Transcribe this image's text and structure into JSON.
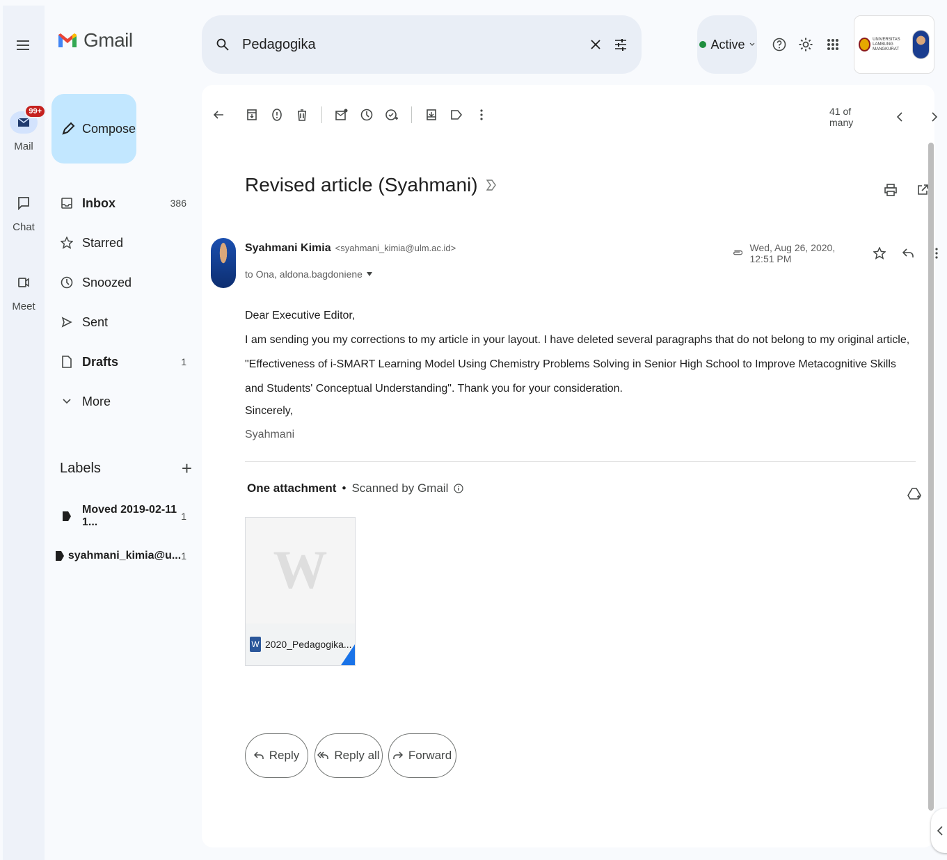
{
  "app": {
    "name": "Gmail"
  },
  "rail": {
    "items": [
      {
        "label": "Mail",
        "badge": "99+"
      },
      {
        "label": "Chat"
      },
      {
        "label": "Meet"
      }
    ]
  },
  "compose": {
    "label": "Compose"
  },
  "nav": {
    "items": [
      {
        "label": "Inbox",
        "count": "386"
      },
      {
        "label": "Starred",
        "count": ""
      },
      {
        "label": "Snoozed",
        "count": ""
      },
      {
        "label": "Sent",
        "count": ""
      },
      {
        "label": "Drafts",
        "count": "1"
      },
      {
        "label": "More",
        "count": ""
      }
    ],
    "labels_title": "Labels",
    "labels": [
      {
        "label": "Moved 2019-02-11 1...",
        "count": "1"
      },
      {
        "label": "syahmani_kimia@u...",
        "count": "1"
      }
    ]
  },
  "search": {
    "value": "Pedagogika"
  },
  "status": {
    "label": "Active",
    "color": "#1e8e3e"
  },
  "account": {
    "org_line1": "UNIVERSITAS",
    "org_line2": "LAMBUNG MANGKURAT"
  },
  "toolbar": {
    "pager": "41 of many"
  },
  "email": {
    "subject": "Revised article (Syahmani)",
    "sender_name": "Syahmani Kimia",
    "sender_email": "<syahmani_kimia@ulm.ac.id>",
    "recipients": "to Ona, aldona.bagdoniene",
    "date": "Wed, Aug 26, 2020, 12:51 PM",
    "greeting": "Dear Executive Editor,",
    "body": "I am sending you my corrections to my article in your layout. I have deleted several paragraphs that do not belong to my original article, \"Effectiveness of i-SMART Learning Model Using Chemistry Problems Solving in Senior High School to Improve Metacognitive Skills and Students' Conceptual Understanding\". Thank you for your consideration.",
    "closing": "Sincerely,",
    "signature": "Syahmani"
  },
  "attachments": {
    "heading": "One attachment",
    "scan_text": "Scanned by Gmail",
    "files": [
      {
        "name": "2020_Pedagogika...",
        "type_letter": "W"
      }
    ]
  },
  "actions": {
    "reply": "Reply",
    "reply_all": "Reply all",
    "forward": "Forward"
  }
}
